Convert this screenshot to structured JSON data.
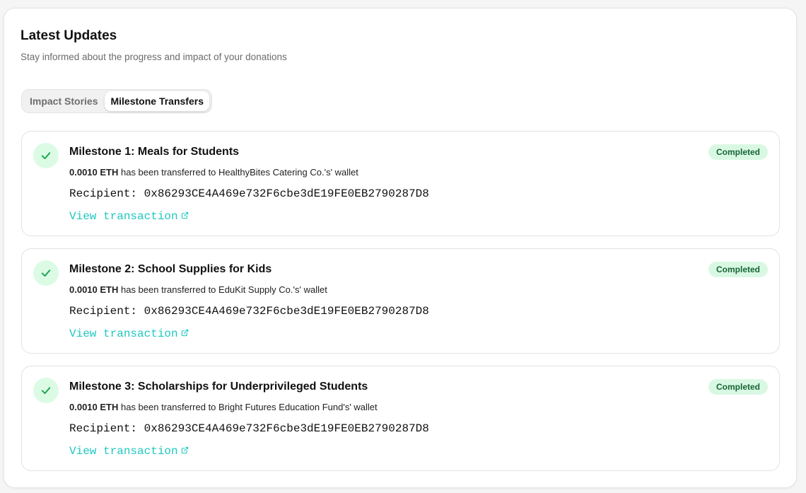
{
  "header": {
    "title": "Latest Updates",
    "subtitle": "Stay informed about the progress and impact of your donations"
  },
  "tabs": [
    {
      "label": "Impact Stories",
      "active": false
    },
    {
      "label": "Milestone Transfers",
      "active": true
    }
  ],
  "milestones": [
    {
      "title": "Milestone 1: Meals for Students",
      "amount": "0.0010 ETH",
      "description": " has been transferred to HealthyBites Catering Co.'s' wallet",
      "recipient": "Recipient: 0x86293CE4A469e732F6cbe3dE19FE0EB2790287D8",
      "link_label": "View transaction",
      "status": "Completed"
    },
    {
      "title": "Milestone 2: School Supplies for Kids",
      "amount": "0.0010 ETH",
      "description": " has been transferred to EduKit Supply Co.'s' wallet",
      "recipient": "Recipient: 0x86293CE4A469e732F6cbe3dE19FE0EB2790287D8",
      "link_label": "View transaction",
      "status": "Completed"
    },
    {
      "title": "Milestone 3: Scholarships for Underprivileged Students",
      "amount": "0.0010 ETH",
      "description": " has been transferred to Bright Futures Education Fund's' wallet",
      "recipient": "Recipient: 0x86293CE4A469e732F6cbe3dE19FE0EB2790287D8",
      "link_label": "View transaction",
      "status": "Completed"
    }
  ],
  "icons": {
    "status": "check-icon",
    "link": "external-link-icon"
  },
  "colors": {
    "accent": "#1ec8c0",
    "success_bg": "#dcfbe5",
    "success_fg": "#16a34a",
    "badge_text": "#166534"
  }
}
